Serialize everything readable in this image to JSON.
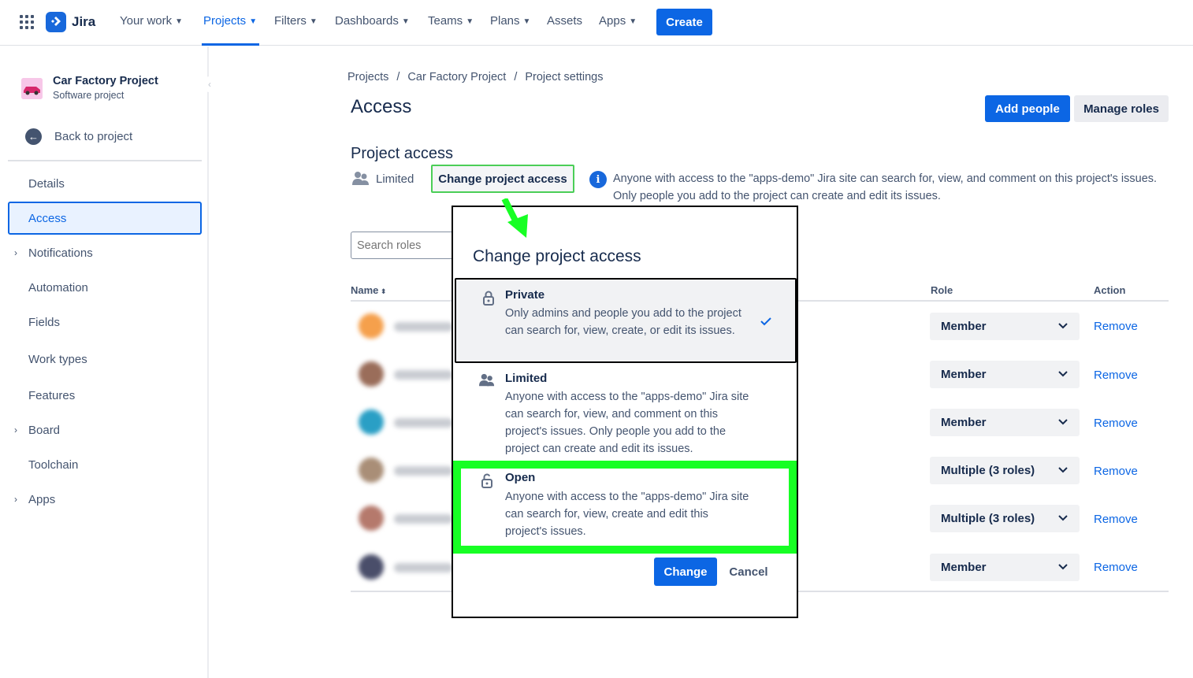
{
  "topnav": {
    "logo_text": "Jira",
    "items": [
      {
        "label": "Your work",
        "has_chevron": true
      },
      {
        "label": "Projects",
        "has_chevron": true,
        "active": true
      },
      {
        "label": "Filters",
        "has_chevron": true
      },
      {
        "label": "Dashboards",
        "has_chevron": true
      },
      {
        "label": "Teams",
        "has_chevron": true
      },
      {
        "label": "Plans",
        "has_chevron": true
      },
      {
        "label": "Assets",
        "has_chevron": false
      },
      {
        "label": "Apps",
        "has_chevron": true
      }
    ],
    "create_label": "Create"
  },
  "sidebar": {
    "project_name": "Car Factory Project",
    "project_type": "Software project",
    "back_label": "Back to project",
    "items": [
      {
        "label": "Details"
      },
      {
        "label": "Access",
        "active": true
      },
      {
        "label": "Notifications",
        "expandable": true
      },
      {
        "label": "Automation"
      },
      {
        "label": "Fields"
      },
      {
        "label": "Work types"
      },
      {
        "label": "Features"
      },
      {
        "label": "Board",
        "expandable": true
      },
      {
        "label": "Toolchain"
      },
      {
        "label": "Apps",
        "expandable": true
      }
    ]
  },
  "breadcrumb": [
    "Projects",
    "/",
    "Car Factory Project",
    "/",
    "Project settings"
  ],
  "page": {
    "title": "Access",
    "add_people_label": "Add people",
    "manage_roles_label": "Manage roles",
    "section_title": "Project access",
    "current_access": "Limited",
    "change_access_label": "Change project access",
    "info_text": "Anyone with access to the \"apps-demo\" Jira site can search for, view, and comment on this project's issues. Only people you add to the project can create and edit its issues.",
    "search_placeholder": "Search roles"
  },
  "table": {
    "headers": {
      "name": "Name",
      "role": "Role",
      "action": "Action"
    },
    "rows": [
      {
        "role": "Member",
        "action": "Remove",
        "avatar_color": "#f5a04c"
      },
      {
        "role": "Member",
        "action": "Remove",
        "avatar_color": "#9a6d5a"
      },
      {
        "role": "Member",
        "action": "Remove",
        "avatar_color": "#2a9fc5"
      },
      {
        "role": "Multiple (3 roles)",
        "action": "Remove",
        "avatar_color": "#a98e77"
      },
      {
        "role": "Multiple (3 roles)",
        "action": "Remove",
        "avatar_color": "#b5796c"
      },
      {
        "role": "Member",
        "action": "Remove",
        "avatar_color": "#4a4e6a"
      }
    ]
  },
  "modal": {
    "title": "Change project access",
    "options": [
      {
        "title": "Private",
        "desc": "Only admins and people you add to the project can search for, view, create, or edit its issues.",
        "selected": true,
        "icon": "lock-icon"
      },
      {
        "title": "Limited",
        "desc": "Anyone with access to the \"apps-demo\" Jira site can search for, view, and comment on this project's issues. Only people you add to the project can create and edit its issues.",
        "selected": false,
        "icon": "people-icon"
      },
      {
        "title": "Open",
        "desc": "Anyone with access to the \"apps-demo\" Jira site can search for, view, create and edit this project's issues.",
        "selected": false,
        "icon": "unlock-icon"
      }
    ],
    "change_label": "Change",
    "cancel_label": "Cancel"
  },
  "colors": {
    "accent": "#0c66e4",
    "highlight": "#17ff24"
  }
}
